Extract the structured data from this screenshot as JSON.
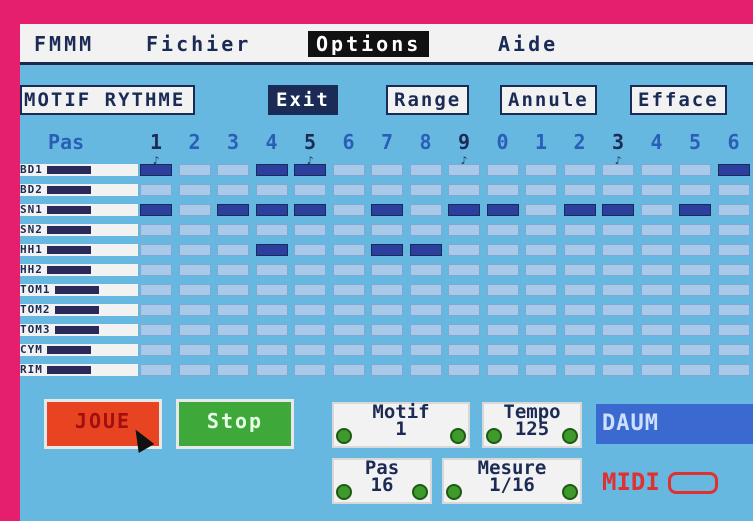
{
  "menu": {
    "app": "FMMM",
    "fichier": "Fichier",
    "options": "Options",
    "aide": "Aide"
  },
  "toolbar": {
    "title": "MOTIF RYTHME",
    "exit": "Exit",
    "range": "Range",
    "annule": "Annule",
    "efface": "Efface"
  },
  "steps": {
    "label": "Pas",
    "numbers": [
      "1",
      "2",
      "3",
      "4",
      "5",
      "6",
      "7",
      "8",
      "9",
      "0",
      "1",
      "2",
      "3",
      "4",
      "5",
      "6"
    ]
  },
  "grid": {
    "rows": [
      {
        "label": "BD1",
        "on": [
          0,
          3,
          4,
          15
        ]
      },
      {
        "label": "BD2",
        "on": []
      },
      {
        "label": "SN1",
        "on": [
          0,
          2,
          3,
          4,
          6,
          8,
          9,
          11,
          12,
          14
        ]
      },
      {
        "label": "SN2",
        "on": []
      },
      {
        "label": "HH1",
        "on": [
          3,
          6,
          7
        ]
      },
      {
        "label": "HH2",
        "on": []
      },
      {
        "label": "TOM1",
        "on": []
      },
      {
        "label": "TOM2",
        "on": []
      },
      {
        "label": "TOM3",
        "on": []
      },
      {
        "label": "CYM",
        "on": []
      },
      {
        "label": "RIM",
        "on": []
      }
    ]
  },
  "controls": {
    "play": "JOUE",
    "stop": "Stop",
    "motif_label": "Motif",
    "motif_value": "1",
    "tempo_label": "Tempo",
    "tempo_value": "125",
    "pas_label": "Pas",
    "pas_value": "16",
    "mesure_label": "Mesure",
    "mesure_value": "1/16"
  },
  "branding": {
    "logo": "DAUM",
    "midi": "MIDI"
  },
  "colors": {
    "frame": "#e61e6e",
    "background": "#67b8e0",
    "cell_off": "#a8c9e8",
    "cell_on": "#2a3f9e",
    "play": "#e84422",
    "stop": "#3fa83a"
  }
}
